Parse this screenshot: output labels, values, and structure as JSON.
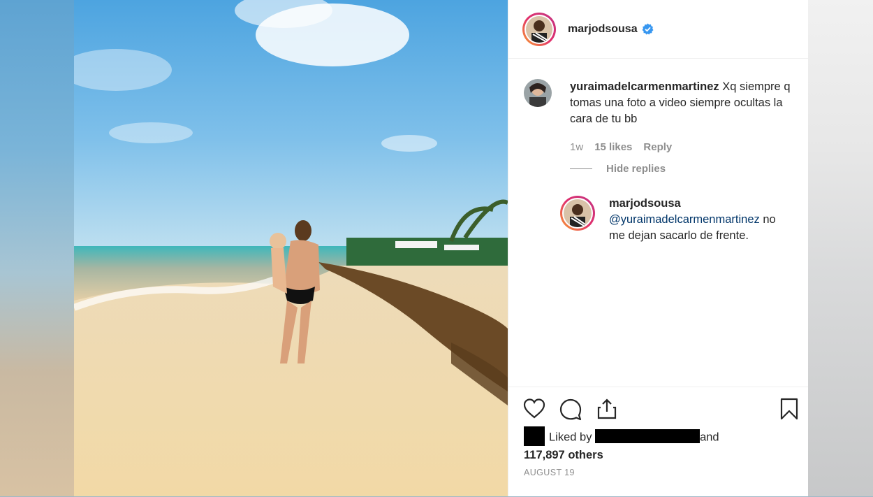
{
  "post": {
    "author": "marjodsousa",
    "verified_icon": "verified-badge-icon",
    "accent_colors": {
      "story_ring_start": "#f9a22f",
      "story_ring_end": "#c13584",
      "mention": "#003569",
      "verified": "#3897f0"
    }
  },
  "comment": {
    "username": "yuraimadelcarmenmartinez",
    "text": "Xq siempre q tomas una foto a video siempre ocultas la cara de tu bb",
    "age": "1w",
    "likes": "15 likes",
    "reply_label": "Reply",
    "hide_replies_label": "Hide replies"
  },
  "reply": {
    "username": "marjodsousa",
    "mention": "@yuraimadelcarmenmartinez",
    "text": "no me dejan sacarlo de frente."
  },
  "actions": {
    "like_icon": "heart-icon",
    "comment_icon": "comment-icon",
    "share_icon": "share-icon",
    "save_icon": "bookmark-icon"
  },
  "likes": {
    "prefix": "Liked by",
    "conjunction": "and",
    "others": "117,897 others"
  },
  "date": "AUGUST 19"
}
